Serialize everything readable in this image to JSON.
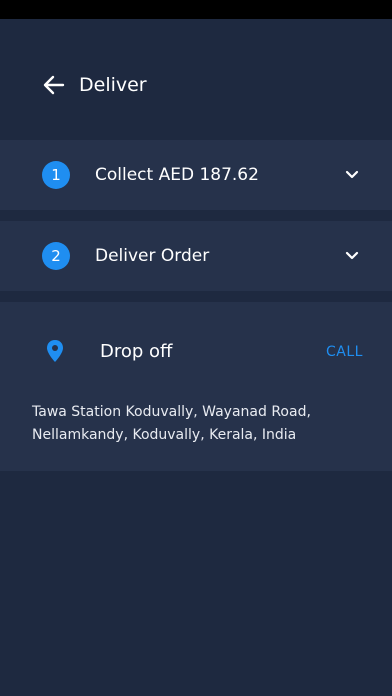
{
  "header": {
    "title": "Deliver",
    "back_icon": "arrow-left-icon"
  },
  "steps": [
    {
      "number": "1",
      "label": "Collect AED 187.62",
      "icon": "chevron-down-icon"
    },
    {
      "number": "2",
      "label": "Deliver Order",
      "icon": "chevron-down-icon"
    }
  ],
  "dropoff": {
    "icon": "location-pin-icon",
    "title": "Drop off",
    "call_label": "CALL",
    "address_lines": [
      "Tawa Station Koduvally, Wayanad Road,",
      "Nellamkandy, Koduvally, Kerala, India"
    ]
  },
  "colors": {
    "background": "#1e2940",
    "card": "#26324b",
    "accent": "#1f8ef1",
    "status_bar": "#000000"
  }
}
